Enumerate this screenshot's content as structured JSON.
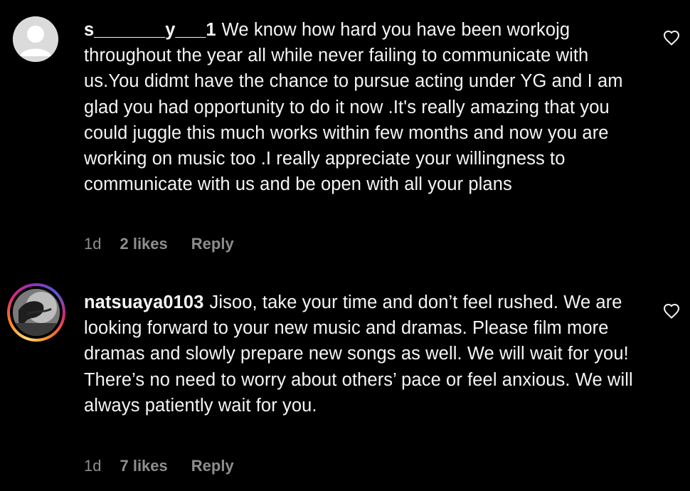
{
  "comments": [
    {
      "username": "s_______y___1",
      "text": "We know how hard you have been workojg throughout the year all while never failing to communicate with us.You didmt have the chance to pursue acting under YG and I am glad you had opportunity to do it now .It's really amazing that you could juggle this much works within few months and now you are working on music too .I really appreciate your willingness to communicate with us and be open with all your plans",
      "time": "1d",
      "likes": "2 likes",
      "reply": "Reply",
      "avatar": "default-avatar-icon"
    },
    {
      "username": "natsuaya0103",
      "text": "Jisoo, take your time and don’t feel rushed. We are looking forward to your new music and dramas. Please film more dramas and slowly prepare new songs as well. We will wait for you! There’s no need to worry about others’ pace or feel anxious. We will always patiently wait for you.",
      "time": "1d",
      "likes": "7 likes",
      "reply": "Reply",
      "avatar": "story-ring-avatar"
    }
  ],
  "colors": {
    "background": "#000000",
    "text": "#f5f5f5",
    "meta": "#8e8e8e",
    "default_avatar": "#dbdbdb"
  },
  "icons": {
    "like": "heart-outline-icon"
  }
}
